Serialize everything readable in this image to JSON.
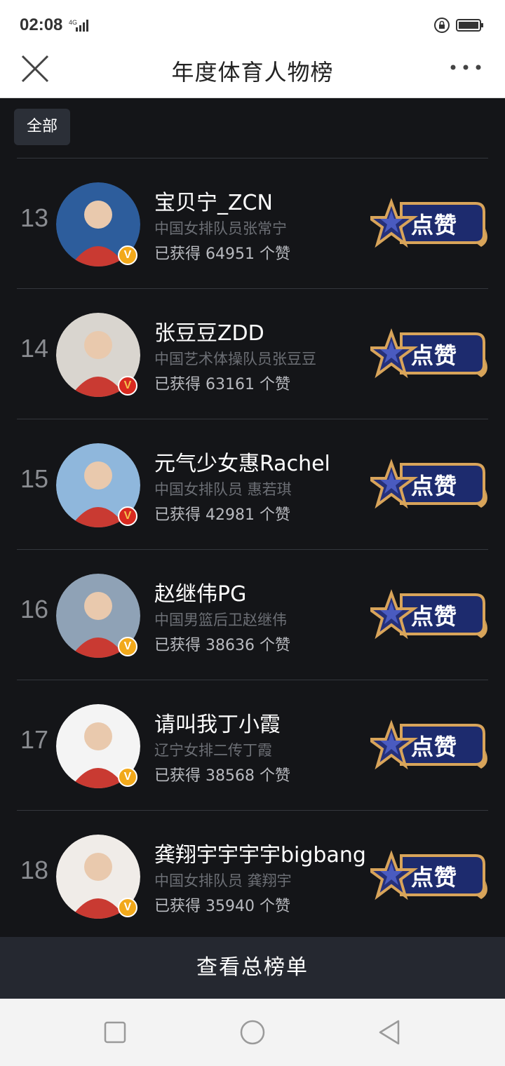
{
  "status": {
    "time": "02:08",
    "network": "4G"
  },
  "header": {
    "title": "年度体育人物榜"
  },
  "filter": {
    "label": "全部"
  },
  "rows": [
    {
      "rank": "13",
      "name": "宝贝宁_ZCN",
      "desc": "中国女排队员张常宁",
      "likes": "已获得  64951  个赞",
      "badge": "gold",
      "avatar_bg": "#2d5d9c",
      "button_label": "点赞"
    },
    {
      "rank": "14",
      "name": "张豆豆ZDD",
      "desc": "中国艺术体操队员张豆豆",
      "likes": "已获得  63161  个赞",
      "badge": "red",
      "avatar_bg": "#d9d5cf",
      "button_label": "点赞"
    },
    {
      "rank": "15",
      "name": "元气少女惠Rachel",
      "desc": "中国女排队员 惠若琪",
      "likes": "已获得  42981  个赞",
      "badge": "red",
      "avatar_bg": "#8fb7dc",
      "button_label": "点赞"
    },
    {
      "rank": "16",
      "name": "赵继伟PG",
      "desc": "中国男篮后卫赵继伟",
      "likes": "已获得  38636  个赞",
      "badge": "gold",
      "avatar_bg": "#8fa2b6",
      "button_label": "点赞"
    },
    {
      "rank": "17",
      "name": "请叫我丁小霞",
      "desc": "辽宁女排二传丁霞",
      "likes": "已获得  38568  个赞",
      "badge": "gold",
      "avatar_bg": "#f4f4f4",
      "button_label": "点赞"
    },
    {
      "rank": "18",
      "name": "龚翔宇宇宇宇bigbang",
      "desc": "中国女排队员 龚翔宇",
      "likes": "已获得  35940  个赞",
      "badge": "gold",
      "avatar_bg": "#f0ece8",
      "button_label": "点赞"
    }
  ],
  "footer": {
    "button_label": "查看总榜单"
  },
  "colors": {
    "accent_gold": "#d8a45a",
    "button_navy": "#1d2b6e",
    "background": "#141518"
  }
}
